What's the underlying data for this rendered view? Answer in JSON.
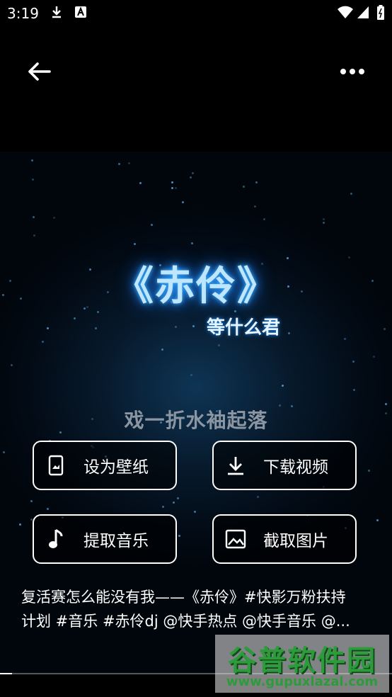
{
  "status_bar": {
    "time": "3:19"
  },
  "video": {
    "title": "《赤伶》",
    "artist": "等什么君",
    "lyric": "戏一折水袖起落"
  },
  "actions": [
    {
      "label": "设为壁纸",
      "icon": "phone-wallpaper-icon"
    },
    {
      "label": "下载视频",
      "icon": "download-icon"
    },
    {
      "label": "提取音乐",
      "icon": "music-note-icon"
    },
    {
      "label": "截取图片",
      "icon": "image-icon"
    }
  ],
  "caption": "复活赛怎么能没有我——《赤伶》#快影万粉扶持\n计划 #音乐 #赤伶dj @快手热点 @快手音乐 @...",
  "progress": 0.03,
  "watermark": {
    "name": "谷普软件园",
    "url": "www.gupuxlazal.com"
  }
}
